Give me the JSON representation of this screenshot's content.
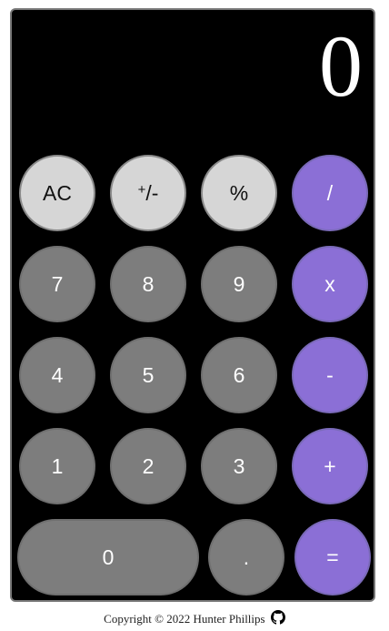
{
  "display": {
    "value": "0"
  },
  "buttons": {
    "ac": "AC",
    "plusminus_sup": "+",
    "plusminus_rest": "/-",
    "percent": "%",
    "divide": "/",
    "seven": "7",
    "eight": "8",
    "nine": "9",
    "multiply": "x",
    "four": "4",
    "five": "5",
    "six": "6",
    "minus": "-",
    "one": "1",
    "two": "2",
    "three": "3",
    "plus": "+",
    "zero": "0",
    "decimal": ".",
    "equals": "="
  },
  "footer": {
    "text": "Copyright © 2022 Hunter Phillips",
    "icon": "github-icon"
  },
  "colors": {
    "operator": "#8b6fd6",
    "function": "#d6d6d6",
    "number": "#7d7d7d",
    "background": "#000000"
  }
}
